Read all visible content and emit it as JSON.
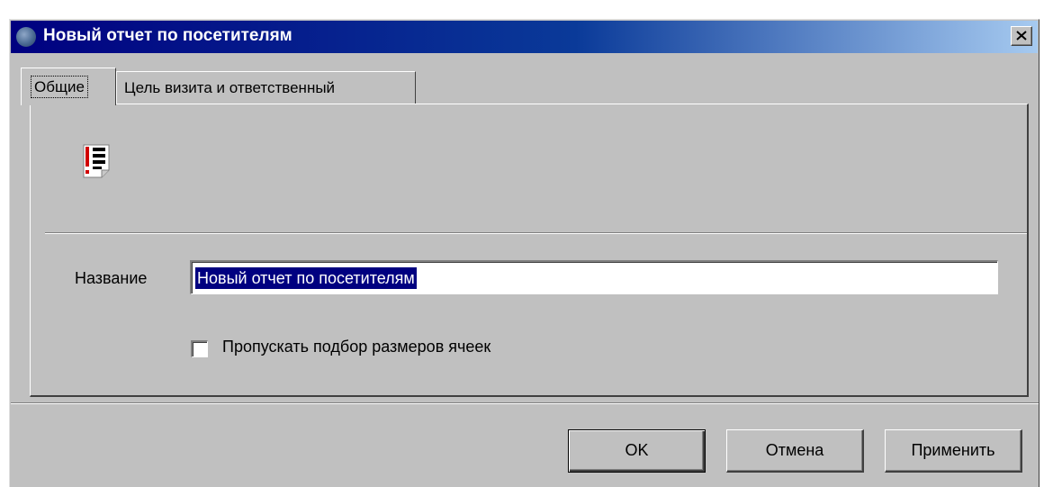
{
  "window": {
    "title": "Новый отчет по посетителям",
    "close_glyph": "×",
    "app_icon": "app-icon"
  },
  "tabs": [
    {
      "label": "Общие",
      "active": true
    },
    {
      "label": "Цель визита и ответственный",
      "active": false
    }
  ],
  "panel": {
    "icon": "report-icon",
    "name_label": "Название",
    "name_value": "Новый отчет по посетителям",
    "checkbox_label": "Пропускать подбор размеров ячеек",
    "checkbox_checked": false
  },
  "buttons": {
    "ok_label": "OK",
    "cancel_label": "Отмена",
    "apply_label": "Применить"
  },
  "colors": {
    "titlebar_start": "#000080",
    "titlebar_end": "#a6caf0",
    "face": "#c0c0c0",
    "selection": "#000080"
  }
}
